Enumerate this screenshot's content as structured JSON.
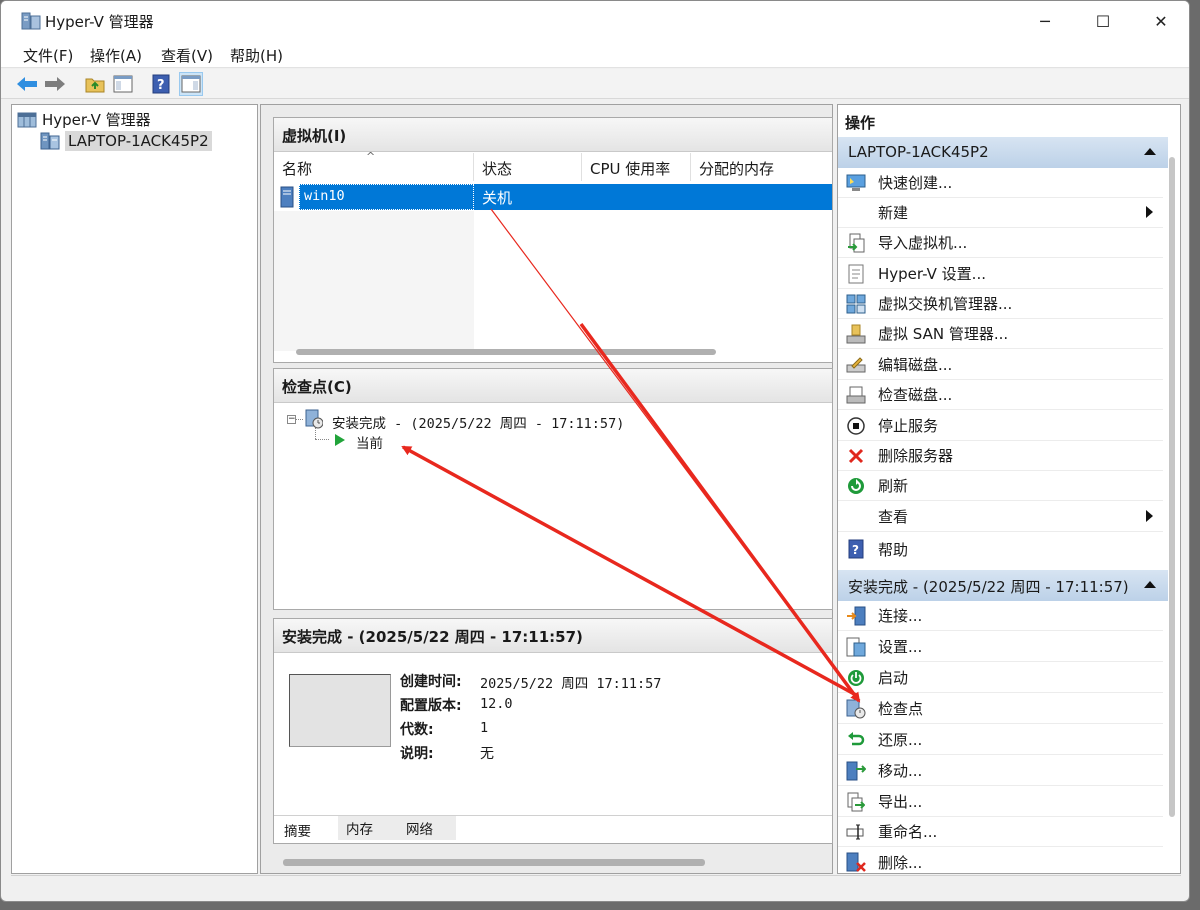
{
  "window": {
    "title": "Hyper-V 管理器"
  },
  "menu": [
    "文件(F)",
    "操作(A)",
    "查看(V)",
    "帮助(H)"
  ],
  "tree": {
    "root": "Hyper-V 管理器",
    "host": "LAPTOP-1ACK45P2"
  },
  "vms": {
    "title": "虚拟机(I)",
    "columns": [
      "名称",
      "状态",
      "CPU 使用率",
      "分配的内存"
    ],
    "rows": [
      {
        "name": "win10",
        "state": "关机"
      }
    ]
  },
  "checkpoints": {
    "title": "检查点(C)",
    "node": "安装完成 - (2025/5/22 周四 - 17:11:57)",
    "current": "当前"
  },
  "details": {
    "title": "安装完成 - (2025/5/22 周四 - 17:11:57)",
    "fields": [
      {
        "label": "创建时间:",
        "value": "2025/5/22 周四 17:11:57"
      },
      {
        "label": "配置版本:",
        "value": "12.0"
      },
      {
        "label": "代数:",
        "value": "1"
      },
      {
        "label": "说明:",
        "value": "无"
      }
    ],
    "tabs": [
      "摘要",
      "内存",
      "网络"
    ]
  },
  "actions": {
    "title": "操作",
    "host_section": "LAPTOP-1ACK45P2",
    "host_items": [
      "快速创建...",
      "新建",
      "导入虚拟机...",
      "Hyper-V 设置...",
      "虚拟交换机管理器...",
      "虚拟 SAN 管理器...",
      "编辑磁盘...",
      "检查磁盘...",
      "停止服务",
      "删除服务器",
      "刷新",
      "查看",
      "帮助"
    ],
    "cp_section": "安装完成 - (2025/5/22 周四 - 17:11:57)",
    "cp_items": [
      "连接...",
      "设置...",
      "启动",
      "检查点",
      "还原...",
      "移动...",
      "导出...",
      "重命名...",
      "删除..."
    ]
  },
  "colors": {
    "selection": "#0078d7",
    "section_band": "#c9daee",
    "arrow": "#e8281e"
  }
}
